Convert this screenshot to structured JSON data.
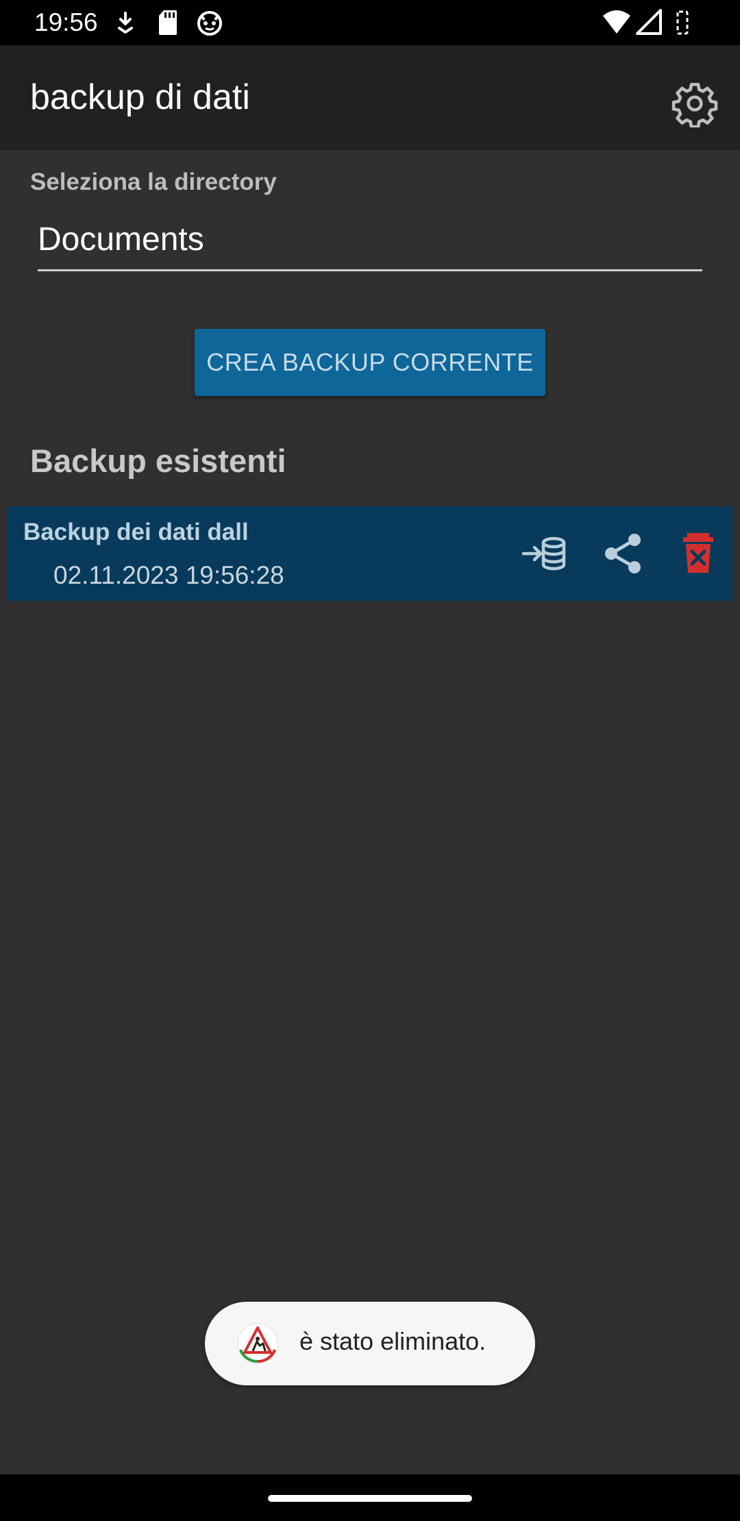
{
  "status_bar": {
    "time": "19:56",
    "icons": [
      "download-arrow-icon",
      "sd-card-icon",
      "cat-face-icon",
      "wifi-icon",
      "cell-signal-icon",
      "battery-icon"
    ]
  },
  "app_bar": {
    "title": "backup di dati",
    "settings_icon": "gear-icon"
  },
  "directory": {
    "label": "Seleziona la directory",
    "value": "Documents"
  },
  "create_button": {
    "label": "CREA BACKUP CORRENTE"
  },
  "existing": {
    "title": "Backup esistenti",
    "items": [
      {
        "name": "Backup dei dati dall",
        "date": "02.11.2023 19:56:28",
        "actions": [
          "restore-database-icon",
          "share-icon",
          "delete-icon"
        ]
      }
    ]
  },
  "toast": {
    "text": "è stato eliminato."
  },
  "colors": {
    "background": "#303030",
    "app_bar": "#212121",
    "button": "#0e6699",
    "row": "#073a5b",
    "delete": "#d32f2f"
  }
}
